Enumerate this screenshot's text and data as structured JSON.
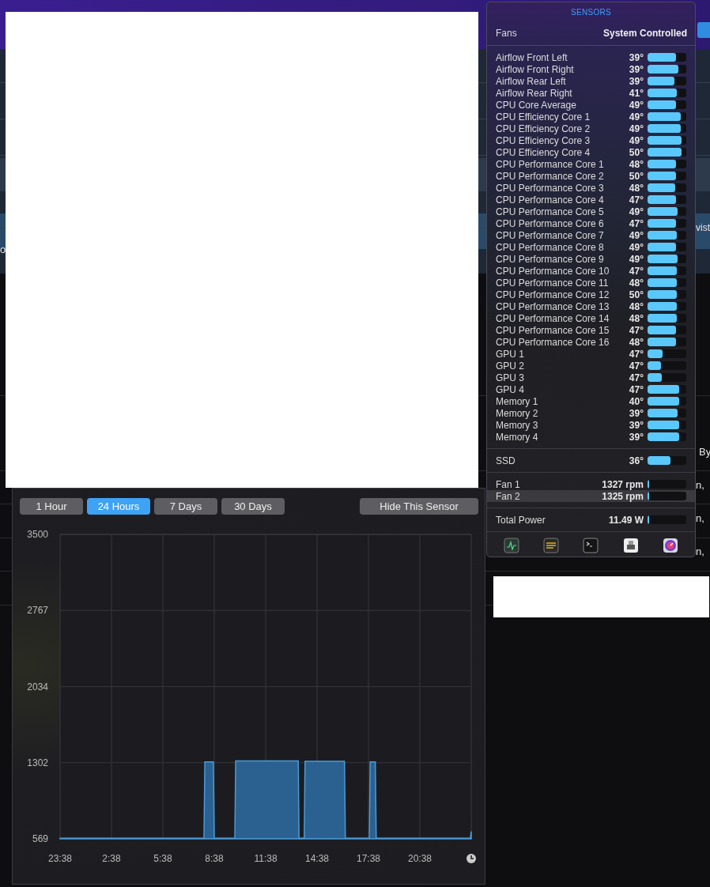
{
  "background_window": {
    "fragments": [
      "o",
      "vist",
      "By",
      "n,",
      "n,",
      "n,"
    ]
  },
  "sensors": {
    "title": "SENSORS",
    "fans_label": "Fans",
    "fans_mode": "System Controlled",
    "groups": [
      {
        "rows": [
          {
            "name": "Airflow Front Left",
            "value": "39°",
            "level": 0.74
          },
          {
            "name": "Airflow Front Right",
            "value": "39°",
            "level": 0.8
          },
          {
            "name": "Airflow Rear Left",
            "value": "39°",
            "level": 0.7
          },
          {
            "name": "Airflow Rear Right",
            "value": "41°",
            "level": 0.76
          },
          {
            "name": "CPU Core Average",
            "value": "49°",
            "level": 0.74
          },
          {
            "name": "CPU Efficiency Core 1",
            "value": "49°",
            "level": 0.86
          },
          {
            "name": "CPU Efficiency Core 2",
            "value": "49°",
            "level": 0.86
          },
          {
            "name": "CPU Efficiency Core 3",
            "value": "49°",
            "level": 0.88
          },
          {
            "name": "CPU Efficiency Core 4",
            "value": "50°",
            "level": 0.88
          },
          {
            "name": "CPU Performance Core 1",
            "value": "48°",
            "level": 0.74
          },
          {
            "name": "CPU Performance Core 2",
            "value": "50°",
            "level": 0.74
          },
          {
            "name": "CPU Performance Core 3",
            "value": "48°",
            "level": 0.72
          },
          {
            "name": "CPU Performance Core 4",
            "value": "47°",
            "level": 0.74
          },
          {
            "name": "CPU Performance Core 5",
            "value": "49°",
            "level": 0.78
          },
          {
            "name": "CPU Performance Core 6",
            "value": "47°",
            "level": 0.74
          },
          {
            "name": "CPU Performance Core 7",
            "value": "49°",
            "level": 0.76
          },
          {
            "name": "CPU Performance Core 8",
            "value": "49°",
            "level": 0.74
          },
          {
            "name": "CPU Performance Core 9",
            "value": "49°",
            "level": 0.78
          },
          {
            "name": "CPU Performance Core 10",
            "value": "47°",
            "level": 0.76
          },
          {
            "name": "CPU Performance Core 11",
            "value": "48°",
            "level": 0.76
          },
          {
            "name": "CPU Performance Core 12",
            "value": "50°",
            "level": 0.76
          },
          {
            "name": "CPU Performance Core 13",
            "value": "48°",
            "level": 0.76
          },
          {
            "name": "CPU Performance Core 14",
            "value": "48°",
            "level": 0.76
          },
          {
            "name": "CPU Performance Core 15",
            "value": "47°",
            "level": 0.74
          },
          {
            "name": "CPU Performance Core 16",
            "value": "48°",
            "level": 0.74
          },
          {
            "name": "GPU 1",
            "value": "47°",
            "level": 0.38
          },
          {
            "name": "GPU 2",
            "value": "47°",
            "level": 0.34
          },
          {
            "name": "GPU 3",
            "value": "47°",
            "level": 0.36
          },
          {
            "name": "GPU 4",
            "value": "47°",
            "level": 0.82
          },
          {
            "name": "Memory 1",
            "value": "40°",
            "level": 0.82
          },
          {
            "name": "Memory 2",
            "value": "39°",
            "level": 0.78
          },
          {
            "name": "Memory 3",
            "value": "39°",
            "level": 0.82
          },
          {
            "name": "Memory 4",
            "value": "39°",
            "level": 0.82
          }
        ]
      },
      {
        "rows": [
          {
            "name": "SSD",
            "value": "36°",
            "level": 0.6
          }
        ]
      },
      {
        "rows": [
          {
            "name": "Fan 1",
            "value": "1327 rpm",
            "level": 0.04,
            "selected": false
          },
          {
            "name": "Fan 2",
            "value": "1325 rpm",
            "level": 0.04,
            "selected": true
          }
        ]
      },
      {
        "rows": [
          {
            "name": "Total Power",
            "value": "11.49 W",
            "level": 0.04
          }
        ]
      }
    ]
  },
  "history": {
    "ranges": [
      {
        "label": "1 Hour",
        "selected": false
      },
      {
        "label": "24 Hours",
        "selected": true
      },
      {
        "label": "7 Days",
        "selected": false
      },
      {
        "label": "30 Days",
        "selected": false
      }
    ],
    "hide_button": "Hide This Sensor",
    "axis_start_label": "23:38",
    "chart_data": {
      "type": "area",
      "x": [
        -0.3667,
        8.0333,
        8.0833,
        8.5833,
        8.6333,
        9.8333,
        9.8833,
        13.5333,
        13.5833,
        13.8833,
        13.9333,
        16.2333,
        16.2833,
        17.6833,
        17.7333,
        18.0333,
        18.0833,
        23.5833,
        23.6333
      ],
      "series": [
        {
          "color": "#2a6190",
          "values": [
            575,
            575,
            1310,
            1310,
            575,
            575,
            1320,
            1320,
            575,
            575,
            1315,
            1315,
            575,
            575,
            1310,
            1310,
            575,
            575,
            640
          ]
        }
      ],
      "xlim": [
        -0.3667,
        23.6333
      ],
      "ylim": [
        569,
        3500
      ],
      "grid": true,
      "xticks": [
        {
          "value": 2.6333,
          "label": "2:38"
        },
        {
          "value": 5.6333,
          "label": "5:38"
        },
        {
          "value": 8.6333,
          "label": "8:38"
        },
        {
          "value": 11.6333,
          "label": "11:38"
        },
        {
          "value": 14.6333,
          "label": "14:38"
        },
        {
          "value": 17.6333,
          "label": "17:38"
        },
        {
          "value": 20.6333,
          "label": "20:38"
        }
      ],
      "yticks": [
        569,
        1302,
        2034,
        2767,
        3500
      ]
    }
  }
}
